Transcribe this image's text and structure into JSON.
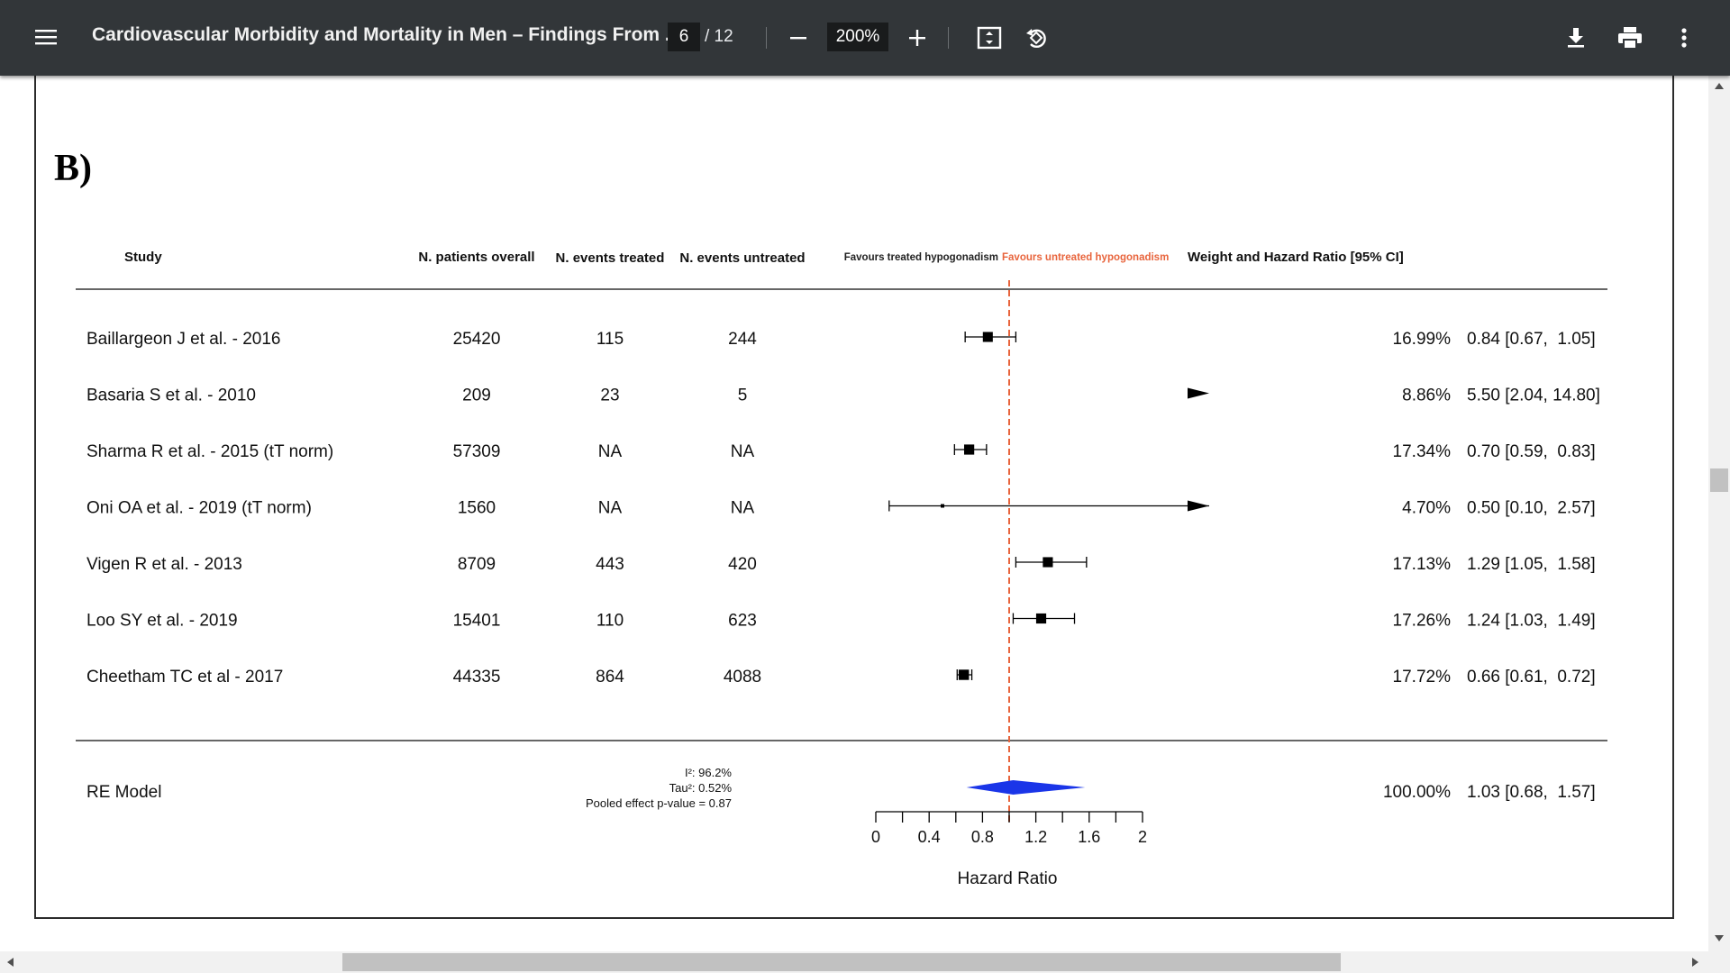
{
  "toolbar": {
    "title": "Cardiovascular Morbidity and Mortality in Men – Findings From ...",
    "page_current": "6",
    "page_total": "/ 12",
    "zoom": "200%",
    "icons": [
      "menu-icon",
      "zoom-out-icon",
      "zoom-in-icon",
      "fit-page-icon",
      "rotate-icon",
      "download-icon",
      "print-icon",
      "more-vert-icon"
    ]
  },
  "figure": {
    "panel_label": "B)",
    "headers": {
      "study": "Study",
      "n_overall": "N. patients overall",
      "n_treated": "N. events treated",
      "n_untreated": "N. events untreated",
      "favours_treated": "Favours treated hypogonadism",
      "favours_untreated": "Favours untreated hypogonadism",
      "weight_hr": "Weight and Hazard Ratio [95% CI]"
    },
    "rows": [
      {
        "study": "Baillargeon J et al. - 2016",
        "n_overall": "25420",
        "n_treated": "115",
        "n_untreated": "244",
        "weight": "16.99%",
        "hr_text": "0.84 [0.67,  1.05]"
      },
      {
        "study": "Basaria S et al. - 2010",
        "n_overall": "209",
        "n_treated": "23",
        "n_untreated": "5",
        "weight": "8.86%",
        "hr_text": "5.50 [2.04, 14.80]"
      },
      {
        "study": "Sharma R et al. - 2015 (tT norm)",
        "n_overall": "57309",
        "n_treated": "NA",
        "n_untreated": "NA",
        "weight": "17.34%",
        "hr_text": "0.70 [0.59,  0.83]"
      },
      {
        "study": "Oni OA et al. - 2019 (tT norm)",
        "n_overall": "1560",
        "n_treated": "NA",
        "n_untreated": "NA",
        "weight": "4.70%",
        "hr_text": "0.50 [0.10,  2.57]"
      },
      {
        "study": "Vigen R et al. - 2013",
        "n_overall": "8709",
        "n_treated": "443",
        "n_untreated": "420",
        "weight": "17.13%",
        "hr_text": "1.29 [1.05,  1.58]"
      },
      {
        "study": "Loo SY et al. - 2019",
        "n_overall": "15401",
        "n_treated": "110",
        "n_untreated": "623",
        "weight": "17.26%",
        "hr_text": "1.24 [1.03,  1.49]"
      },
      {
        "study": "Cheetham TC et al - 2017",
        "n_overall": "44335",
        "n_treated": "864",
        "n_untreated": "4088",
        "weight": "17.72%",
        "hr_text": "0.66 [0.61,  0.72]"
      }
    ],
    "summary": {
      "label": "RE Model",
      "i2": "I²: 96.2%",
      "tau2": "Tau²: 0.52%",
      "pvalue": "Pooled effect p-value = 0.87",
      "weight": "100.00%",
      "hr_text": "1.03 [0.68,  1.57]"
    }
  },
  "chart_data": {
    "type": "forest",
    "xlabel": "Hazard Ratio",
    "xlim": [
      0,
      2
    ],
    "ticks": [
      "0",
      "0.4",
      "0.8",
      "1.2",
      "1.6",
      "2"
    ],
    "reference_line": 1,
    "points": [
      {
        "study": "Baillargeon J et al. - 2016",
        "hr": 0.84,
        "lo": 0.67,
        "hi": 1.05,
        "weight": 16.99
      },
      {
        "study": "Basaria S et al. - 2010",
        "hr": 5.5,
        "lo": 2.04,
        "hi": 14.8,
        "weight": 8.86
      },
      {
        "study": "Sharma R et al. - 2015 (tT norm)",
        "hr": 0.7,
        "lo": 0.59,
        "hi": 0.83,
        "weight": 17.34
      },
      {
        "study": "Oni OA et al. - 2019 (tT norm)",
        "hr": 0.5,
        "lo": 0.1,
        "hi": 2.57,
        "weight": 4.7
      },
      {
        "study": "Vigen R et al. - 2013",
        "hr": 1.29,
        "lo": 1.05,
        "hi": 1.58,
        "weight": 17.13
      },
      {
        "study": "Loo SY et al. - 2019",
        "hr": 1.24,
        "lo": 1.03,
        "hi": 1.49,
        "weight": 17.26
      },
      {
        "study": "Cheetham TC et al - 2017",
        "hr": 0.66,
        "lo": 0.61,
        "hi": 0.72,
        "weight": 17.72
      }
    ],
    "pooled": {
      "hr": 1.03,
      "lo": 0.68,
      "hi": 1.57
    },
    "colors": {
      "reference_line": "#e8643c",
      "pooled_diamond": "#1a35e8",
      "favours_untreated": "#e8643c",
      "markers": "#000000"
    }
  }
}
